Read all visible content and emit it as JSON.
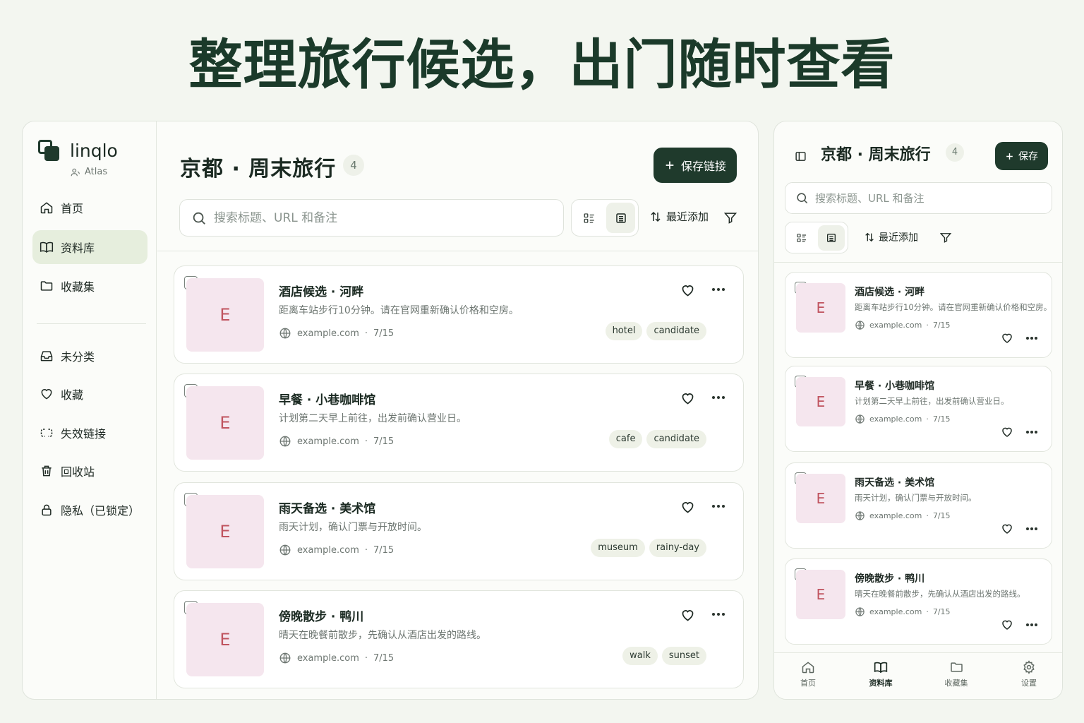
{
  "headline": "整理旅行候选，出门随时查看",
  "app": {
    "brand": "linqlo",
    "account": "Atlas"
  },
  "sidebar": {
    "items": [
      {
        "label": "首页",
        "icon": "home-icon"
      },
      {
        "label": "资料库",
        "icon": "book-icon",
        "active": true
      },
      {
        "label": "收藏集",
        "icon": "folder-icon"
      },
      {
        "label": "未分类",
        "icon": "inbox-icon"
      },
      {
        "label": "收藏",
        "icon": "heart-icon"
      },
      {
        "label": "失效链接",
        "icon": "broken-link-icon"
      },
      {
        "label": "回收站",
        "icon": "trash-icon"
      },
      {
        "label": "隐私（已锁定）",
        "icon": "lock-icon"
      }
    ]
  },
  "collection": {
    "title": "京都 · 周末旅行",
    "count": "4"
  },
  "toolbar": {
    "save_label": "保存链接",
    "mobile_save_label": "保存",
    "search_placeholder": "搜索标题、URL 和备注",
    "sort_label": "最近添加"
  },
  "items": [
    {
      "thumb": "E",
      "title": "酒店候选 · 河畔",
      "desc": "距离车站步行10分钟。请在官网重新确认价格和空房。",
      "domain": "example.com",
      "date": "7/15",
      "tags": [
        "hotel",
        "candidate"
      ]
    },
    {
      "thumb": "E",
      "title": "早餐 · 小巷咖啡馆",
      "desc": "计划第二天早上前往，出发前确认营业日。",
      "domain": "example.com",
      "date": "7/15",
      "tags": [
        "cafe",
        "candidate"
      ]
    },
    {
      "thumb": "E",
      "title": "雨天备选 · 美术馆",
      "desc": "雨天计划，确认门票与开放时间。",
      "domain": "example.com",
      "date": "7/15",
      "tags": [
        "museum",
        "rainy-day"
      ]
    },
    {
      "thumb": "E",
      "title": "傍晚散步 · 鸭川",
      "desc": "晴天在晚餐前散步，先确认从酒店出发的路线。",
      "domain": "example.com",
      "date": "7/15",
      "tags": [
        "walk",
        "sunset"
      ]
    }
  ],
  "meta_sep": "·",
  "bottom_nav": [
    {
      "label": "首页",
      "icon": "home-icon"
    },
    {
      "label": "资料库",
      "icon": "book-icon",
      "active": true
    },
    {
      "label": "收藏集",
      "icon": "folder-icon"
    },
    {
      "label": "设置",
      "icon": "gear-icon"
    }
  ],
  "colors": {
    "accent": "#1f3a2c",
    "active_bg": "#e6eedd",
    "thumb_bg": "#f5e6ee",
    "thumb_text": "#c0545f",
    "page_bg": "#f3f6f0"
  }
}
